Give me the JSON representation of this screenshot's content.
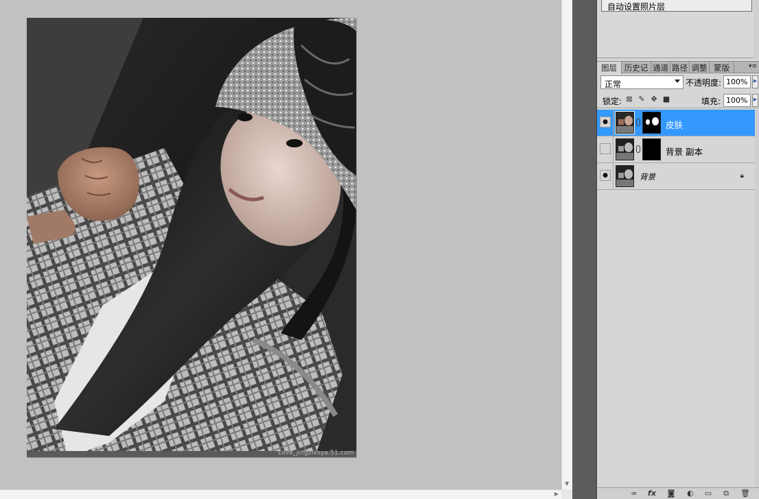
{
  "canvas": {
    "watermark": "Love_jingzivsya.51.com"
  },
  "actions_panel": {
    "item_label": "自动设置照片层"
  },
  "tabs": [
    {
      "label": "图层",
      "active": true
    },
    {
      "label": "历史记",
      "active": false
    },
    {
      "label": "通道",
      "active": false
    },
    {
      "label": "路径",
      "active": false
    },
    {
      "label": "调整",
      "active": false
    },
    {
      "label": "蒙版",
      "active": false
    }
  ],
  "layer_options": {
    "blend_mode": "正常",
    "opacity_label": "不透明度:",
    "opacity_value": "100%",
    "lock_label": "锁定:",
    "fill_label": "填充:",
    "fill_value": "100%"
  },
  "layers": [
    {
      "name": "皮肤",
      "visible": true,
      "selected": true,
      "has_mask": true
    },
    {
      "name": "背景 副本",
      "visible": false,
      "selected": false,
      "has_mask": true
    },
    {
      "name": "背景",
      "visible": true,
      "selected": false,
      "has_mask": false,
      "locked": true
    }
  ],
  "colors": {
    "selection": "#3399ff",
    "panel_bg": "#d6d6d6",
    "canvas_bg": "#c1c1c1"
  }
}
